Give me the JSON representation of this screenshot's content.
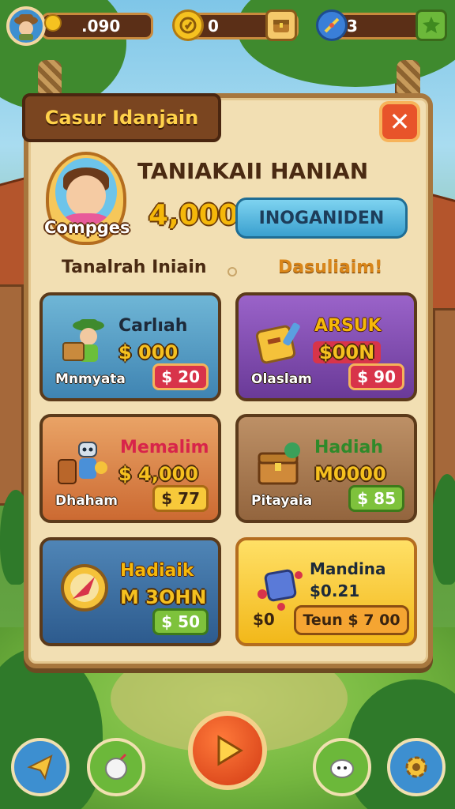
{
  "hud": {
    "currency_1": ".090",
    "currency_2": "0",
    "currency_3": "3"
  },
  "panel": {
    "title": "Casur Idanjain",
    "close_label": "✕"
  },
  "player": {
    "badge_label": "Compges",
    "name": "TANIAKAII HANIAN",
    "score": "4,000",
    "action_label": "INOGANIDEN"
  },
  "sections": {
    "left": "Tanalrah Iniain",
    "right": "Dasuliaim!"
  },
  "cards": [
    {
      "title": "Carlıah",
      "amount": "$ 000",
      "sub": "Mnmyata",
      "price": "$ 20"
    },
    {
      "title": "ARSUK",
      "amount": "$00N",
      "sub": "Olaslam",
      "price": "$ 90"
    },
    {
      "title": "Memalim",
      "amount": "$ 4,000",
      "sub": "Dhaham",
      "price": "$ 77"
    },
    {
      "title": "Hadiah",
      "amount": "M0000",
      "sub": "Pitayaia",
      "price": "$ 85"
    },
    {
      "title": "Hadiaik",
      "amount": "M 3OHN",
      "sub": "",
      "price": "$ 50"
    },
    {
      "title": "Mandina",
      "amount": "$0.21",
      "sub": "$0",
      "price": "Teun $ 7 00"
    }
  ],
  "colors": {
    "board": "#f2dfb3",
    "title_bar": "#7a4520",
    "gold_text": "#f5c01f",
    "play_button": "#d23a14"
  },
  "icons": {
    "hud": [
      "explorer-avatar-icon",
      "coin-icon",
      "treasure-box-icon",
      "compass-gem-icon",
      "map-leaf-icon"
    ],
    "nav": [
      "paper-plane-icon",
      "bomb-icon",
      "play-icon",
      "cloud-pet-icon",
      "gear-icon"
    ]
  }
}
